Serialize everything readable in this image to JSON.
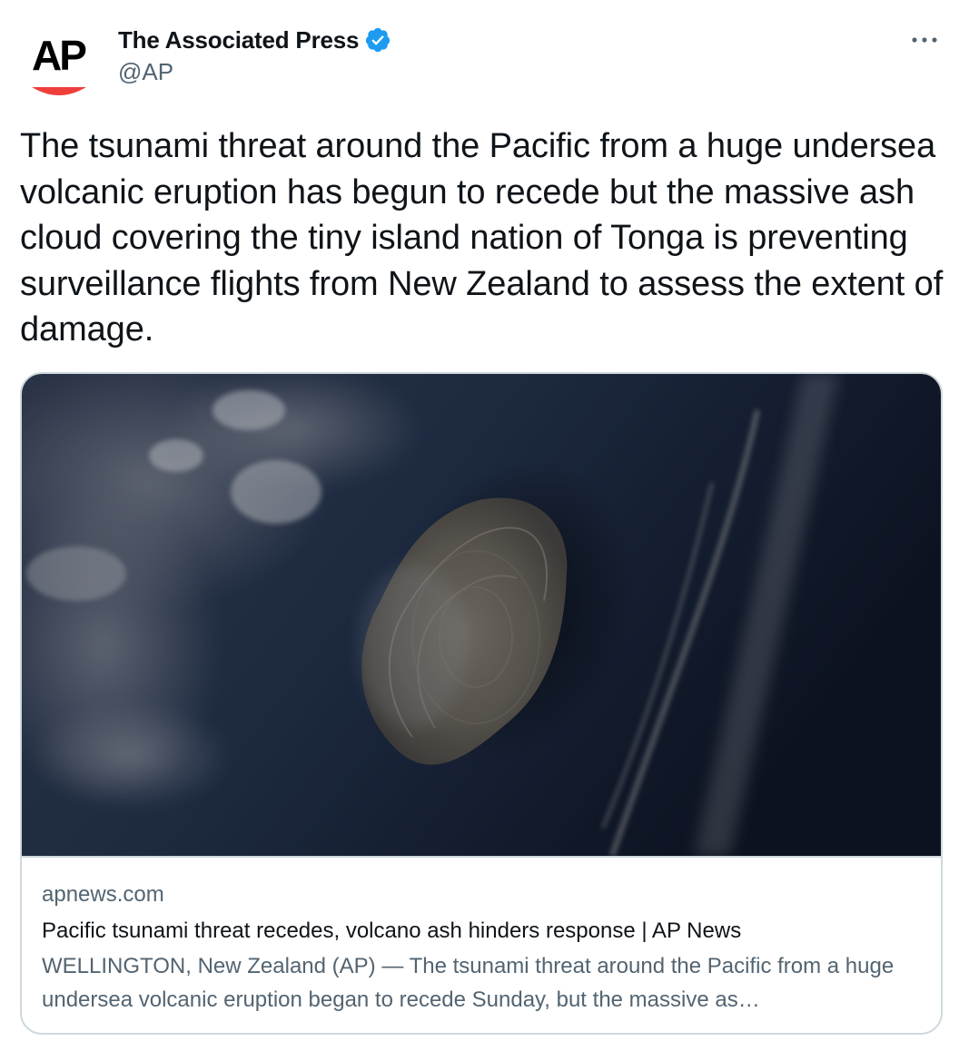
{
  "author": {
    "display_name": "The Associated Press",
    "handle": "@AP",
    "avatar_text": "AP",
    "verified": true,
    "avatar_icon": "ap-logo",
    "brand_red": "#ef3f3b"
  },
  "tweet": {
    "text": "The tsunami threat around the Pacific from a huge undersea volcanic eruption has begun to recede but the massive ash cloud covering the tiny island nation of Tonga is preventing surveillance flights from New Zealand to assess the extent of damage."
  },
  "card": {
    "domain": "apnews.com",
    "title": "Pacific tsunami threat recedes, volcano ash hinders response | AP News",
    "description": "WELLINGTON, New Zealand (AP) — The tsunami threat around the Pacific from a huge undersea volcanic eruption began to recede Sunday, but the massive as…",
    "image_icon": "satellite-eruption-image"
  },
  "colors": {
    "verified_blue": "#1d9bf0",
    "text_primary": "#0f1419",
    "text_secondary": "#536471",
    "border": "#cfd9de"
  },
  "icons": {
    "more": "more-options-icon",
    "verified": "verified-badge-icon"
  }
}
